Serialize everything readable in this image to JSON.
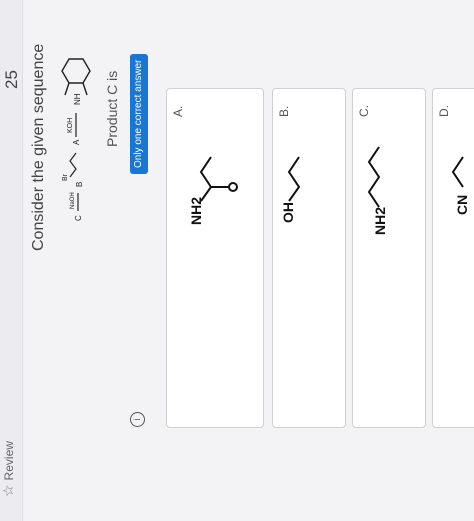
{
  "question": {
    "number": "25",
    "review_label": "Review",
    "text": "Consider the given sequence",
    "product_text": "Product C is",
    "hint_badge": "Only one correct answer",
    "reagents": {
      "step1": "KOH",
      "step2_label": "A",
      "step3": "Br",
      "step4": "NaOH",
      "step4_label": "B",
      "step5": "C"
    }
  },
  "options": [
    {
      "letter": "A.",
      "group": "NH2"
    },
    {
      "letter": "B.",
      "group": "OH"
    },
    {
      "letter": "C.",
      "group": "NH2"
    },
    {
      "letter": "D.",
      "group": "CN"
    }
  ],
  "colors": {
    "accent": "#1976d2"
  }
}
